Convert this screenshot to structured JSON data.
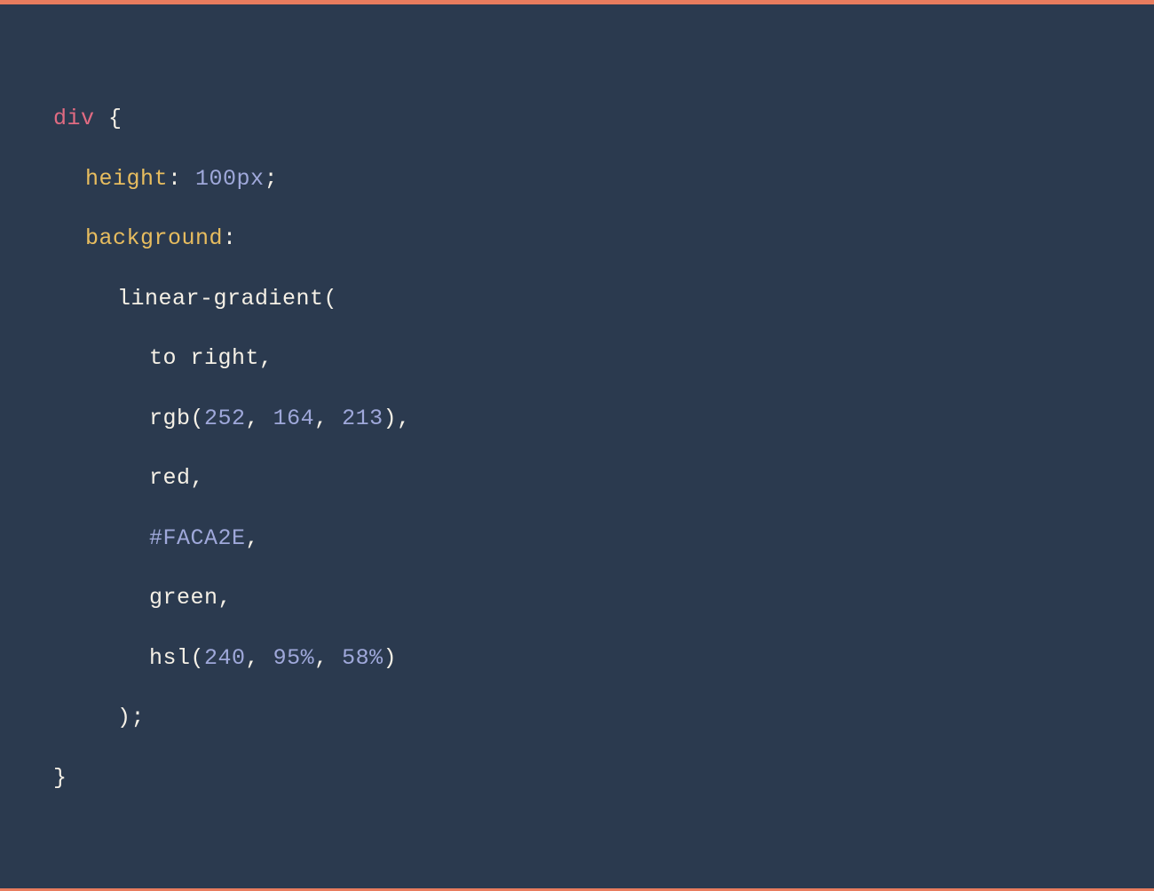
{
  "code": {
    "selector": "div",
    "brace_open": " {",
    "brace_close": "}",
    "prop_height": "height",
    "colon": ": ",
    "colon_only": ":",
    "height_val": "100",
    "height_unit": "px",
    "semicolon": ";",
    "prop_background": "background",
    "func_linear_gradient": "linear-gradient",
    "paren_open": "(",
    "paren_close": ")",
    "comma": ",",
    "to_right": "to right",
    "func_rgb": "rgb",
    "rgb_r": "252",
    "rgb_g": "164",
    "rgb_b": "213",
    "color_red": "red",
    "hex_faca2e": "#FACA2E",
    "color_green": "green",
    "func_hsl": "hsl",
    "hsl_h": "240",
    "hsl_s": "95",
    "hsl_l": "58",
    "percent": "%",
    "space": " ",
    "paren_close_semi": ");"
  },
  "colors": {
    "background": "#2b3a4f",
    "accent_border": "#e87c5e",
    "selector": "#e06b82",
    "property": "#e8bd5f",
    "number": "#9fa8da",
    "text": "#f5f0e6"
  }
}
